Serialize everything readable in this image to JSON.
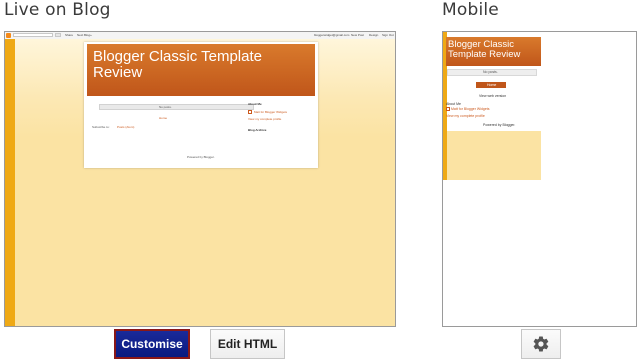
{
  "sections": {
    "live": "Live on Blog",
    "mobile": "Mobile"
  },
  "desktop_preview": {
    "topbar": {
      "share": "Share",
      "next": "Next Blog»",
      "email": "bloggerwidget@gmail.com",
      "new_post": "New Post",
      "design": "Design",
      "sign_out": "Sign Out"
    },
    "blog_title": "Blogger Classic Template Review",
    "no_posts": "No posts.",
    "home": "Home",
    "subscribe": "Subscribe to:",
    "subscribe_link": "Posts (Atom)",
    "about_heading": "About Me",
    "profile_name": "Matt for Blogger Widgets",
    "profile_link": "View my complete profile",
    "archive_heading": "Blog Archive",
    "powered_by": "Powered by Blogger."
  },
  "mobile_preview": {
    "blog_title": "Blogger Classic Template Review",
    "no_posts": "No posts.",
    "home": "Home",
    "web_version": "View web version",
    "about_heading": "About Me",
    "profile_name": "Matt for Blogger Widgets",
    "profile_link": "View my complete profile",
    "powered_by": "Powered by Blogger."
  },
  "buttons": {
    "customise": "Customise",
    "edit_html": "Edit HTML",
    "mobile_settings_icon": "gear-icon"
  },
  "colors": {
    "header_orange": "#c0561a",
    "sidebar_orange": "#efa915",
    "page_cream": "#fbe3a3",
    "customise_blue": "#0a1a80"
  }
}
